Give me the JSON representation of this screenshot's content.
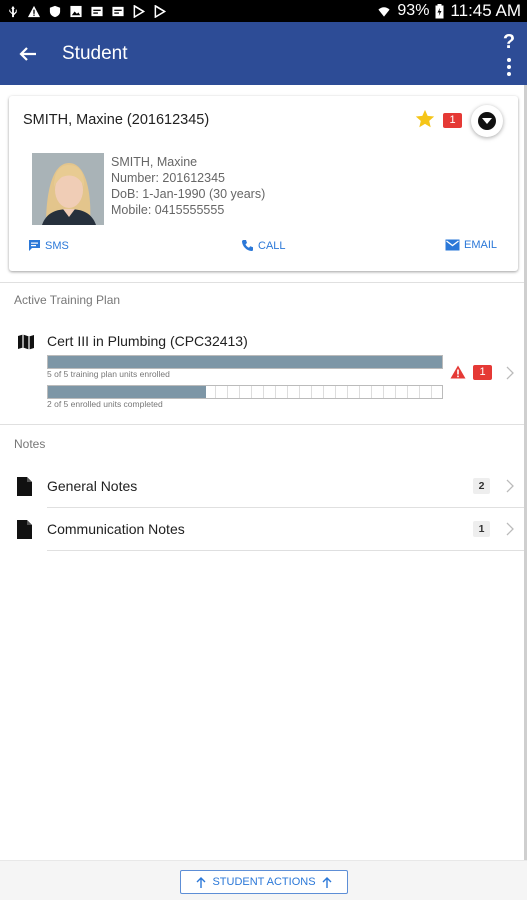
{
  "status_bar": {
    "battery": "93%",
    "time": "11:45 AM",
    "left_icons": [
      "usb-icon",
      "alert-icon",
      "shield-icon",
      "image-icon",
      "mail-icon",
      "mail-icon",
      "play-store-icon",
      "play-store-icon"
    ]
  },
  "app_bar": {
    "title": "Student",
    "help_label": "?",
    "background": "#2d4c96"
  },
  "student_card": {
    "header_name": "SMITH, Maxine (201612345)",
    "flag_count": "1",
    "details": {
      "name": "SMITH, Maxine",
      "number": "Number: 201612345",
      "dob": "DoB: 1-Jan-1990 (30 years)",
      "mobile": "Mobile: 0415555555"
    },
    "actions": {
      "sms": "SMS",
      "call": "CALL",
      "email": "EMAIL"
    }
  },
  "training": {
    "section_label": "Active Training Plan",
    "plan_title": "Cert III in Plumbing (CPC32413)",
    "enrolled_caption": "5 of 5 training plan units enrolled",
    "enrolled_fraction": 1.0,
    "completed_caption": "2 of 5 enrolled units completed",
    "completed_fraction": 0.4,
    "warning_count": "1"
  },
  "notes": {
    "section_label": "Notes",
    "items": [
      {
        "label": "General Notes",
        "count": "2"
      },
      {
        "label": "Communication Notes",
        "count": "1"
      }
    ]
  },
  "bottom": {
    "student_actions_label": "STUDENT ACTIONS"
  },
  "colors": {
    "accent": "#2b78d8",
    "badge": "#e53935",
    "star": "#f5c518",
    "bar_fill": "#7d96a6"
  }
}
